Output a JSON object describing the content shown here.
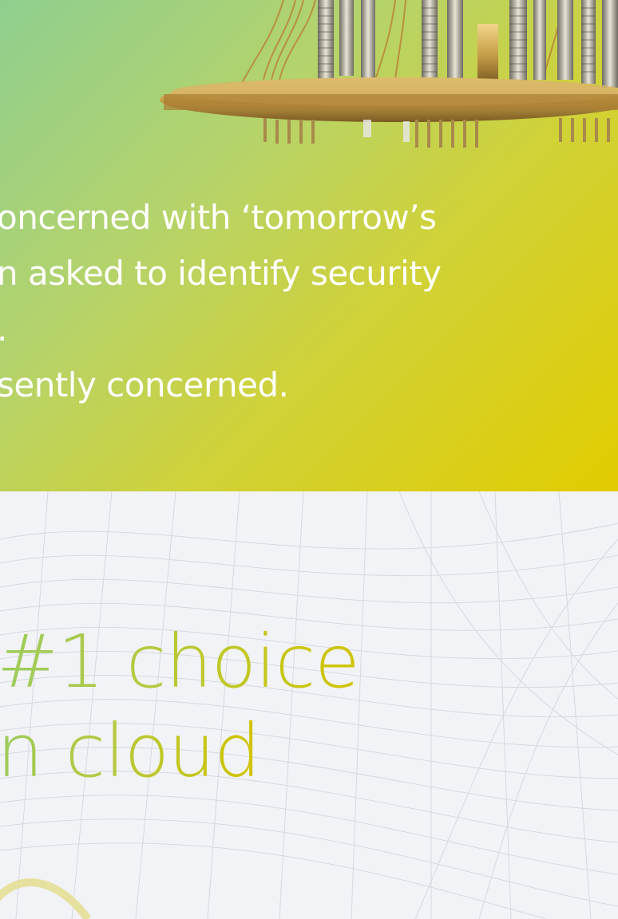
{
  "intro": {
    "lines": [
      "oncerned with ‘tomorrow’s",
      "n asked to identify security",
      ".",
      "sently concerned."
    ]
  },
  "headline": {
    "lines": [
      "#1 choice",
      "n cloud"
    ]
  },
  "colors": {
    "gradient_green": "#8fcf8f",
    "gradient_yellow": "#e2cc00",
    "headline_green": "#9ccc5e",
    "headline_yellow": "#d2c400",
    "hardware_gold": "#c9a14a"
  },
  "images": {
    "hardware": "quantum-computer-chandelier",
    "background_pattern": "wireframe-mesh-pattern"
  }
}
